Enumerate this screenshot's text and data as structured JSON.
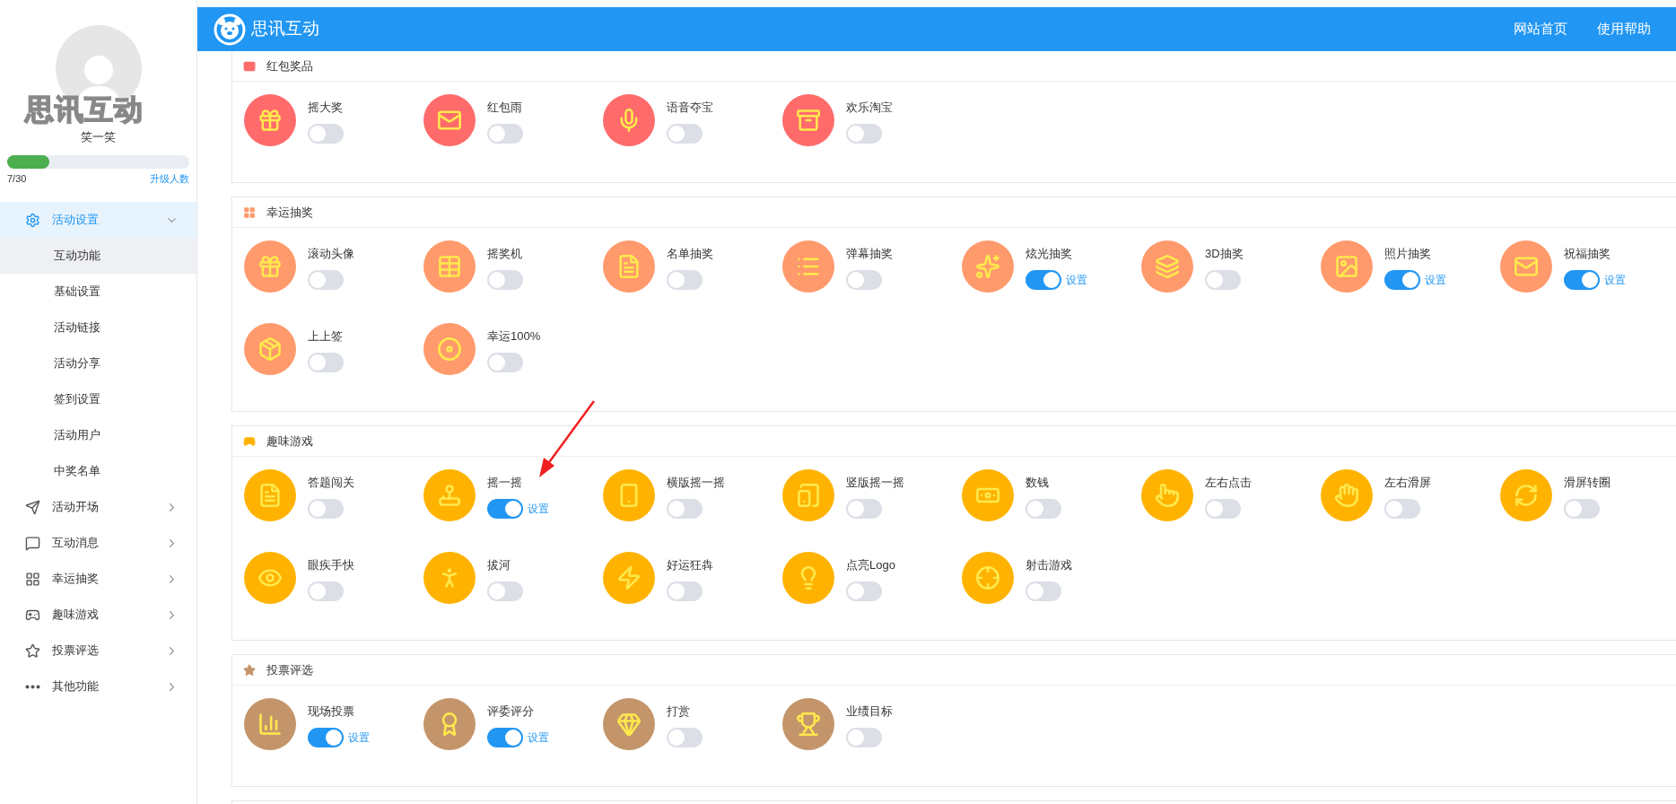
{
  "header": {
    "brand": "思讯互动",
    "links": [
      "网站首页",
      "使用帮助"
    ]
  },
  "sidebar": {
    "logo_text": "思讯互动",
    "user_name": "笑一笑",
    "quota": {
      "level": 0.233,
      "reading": "7/30",
      "upgrade_link": "升级人数"
    },
    "menu": [
      {
        "label": "活动设置",
        "expanded": true,
        "children": [
          {
            "label": "互动功能",
            "selected": true
          },
          {
            "label": "基础设置",
            "selected": false
          },
          {
            "label": "活动链接",
            "selected": false
          },
          {
            "label": "活动分享",
            "selected": false
          },
          {
            "label": "签到设置",
            "selected": false
          },
          {
            "label": "活动用户",
            "selected": false
          },
          {
            "label": "中奖名单",
            "selected": false
          }
        ]
      },
      {
        "label": "活动开场",
        "expanded": false
      },
      {
        "label": "互动消息",
        "expanded": false
      },
      {
        "label": "幸运抽奖",
        "expanded": false
      },
      {
        "label": "趣味游戏",
        "expanded": false
      },
      {
        "label": "投票评选",
        "expanded": false
      },
      {
        "label": "其他功能",
        "expanded": false
      }
    ]
  },
  "sections": [
    {
      "title": "红包奖品",
      "color": "#ff6b6b",
      "items": [
        {
          "label": "摇大奖",
          "on": false
        },
        {
          "label": "红包雨",
          "on": false
        },
        {
          "label": "语音夺宝",
          "on": false
        },
        {
          "label": "欢乐淘宝",
          "on": false
        }
      ]
    },
    {
      "title": "幸运抽奖",
      "color": "#ff9a6c",
      "items": [
        {
          "label": "滚动头像",
          "on": false
        },
        {
          "label": "摇奖机",
          "on": false
        },
        {
          "label": "名单抽奖",
          "on": false
        },
        {
          "label": "弹幕抽奖",
          "on": false
        },
        {
          "label": "炫光抽奖",
          "on": true,
          "settings_link": "设置"
        },
        {
          "label": "3D抽奖",
          "on": false
        },
        {
          "label": "照片抽奖",
          "on": true,
          "settings_link": "设置"
        },
        {
          "label": "祝福抽奖",
          "on": true,
          "settings_link": "设置"
        },
        {
          "label": "上上签",
          "on": false
        },
        {
          "label": "幸运100%",
          "on": false
        }
      ]
    },
    {
      "title": "趣味游戏",
      "color": "#ffb300",
      "items": [
        {
          "label": "答题闯关",
          "on": false
        },
        {
          "label": "摇一摇",
          "on": true,
          "settings_link": "设置"
        },
        {
          "label": "横版摇一摇",
          "on": false
        },
        {
          "label": "竖版摇一摇",
          "on": false
        },
        {
          "label": "数钱",
          "on": false
        },
        {
          "label": "左右点击",
          "on": false
        },
        {
          "label": "左右滑屏",
          "on": false
        },
        {
          "label": "滑屏转圈",
          "on": false
        },
        {
          "label": "眼疾手快",
          "on": false
        },
        {
          "label": "拔河",
          "on": false
        },
        {
          "label": "好运狂犇",
          "on": false
        },
        {
          "label": "点亮Logo",
          "on": false
        },
        {
          "label": "射击游戏",
          "on": false
        }
      ]
    },
    {
      "title": "投票评选",
      "color": "#c4956a",
      "items": [
        {
          "label": "现场投票",
          "on": true,
          "settings_link": "设置"
        },
        {
          "label": "评委评分",
          "on": true,
          "settings_link": "设置"
        },
        {
          "label": "打赏",
          "on": false
        },
        {
          "label": "业绩目标",
          "on": false
        }
      ]
    }
  ]
}
